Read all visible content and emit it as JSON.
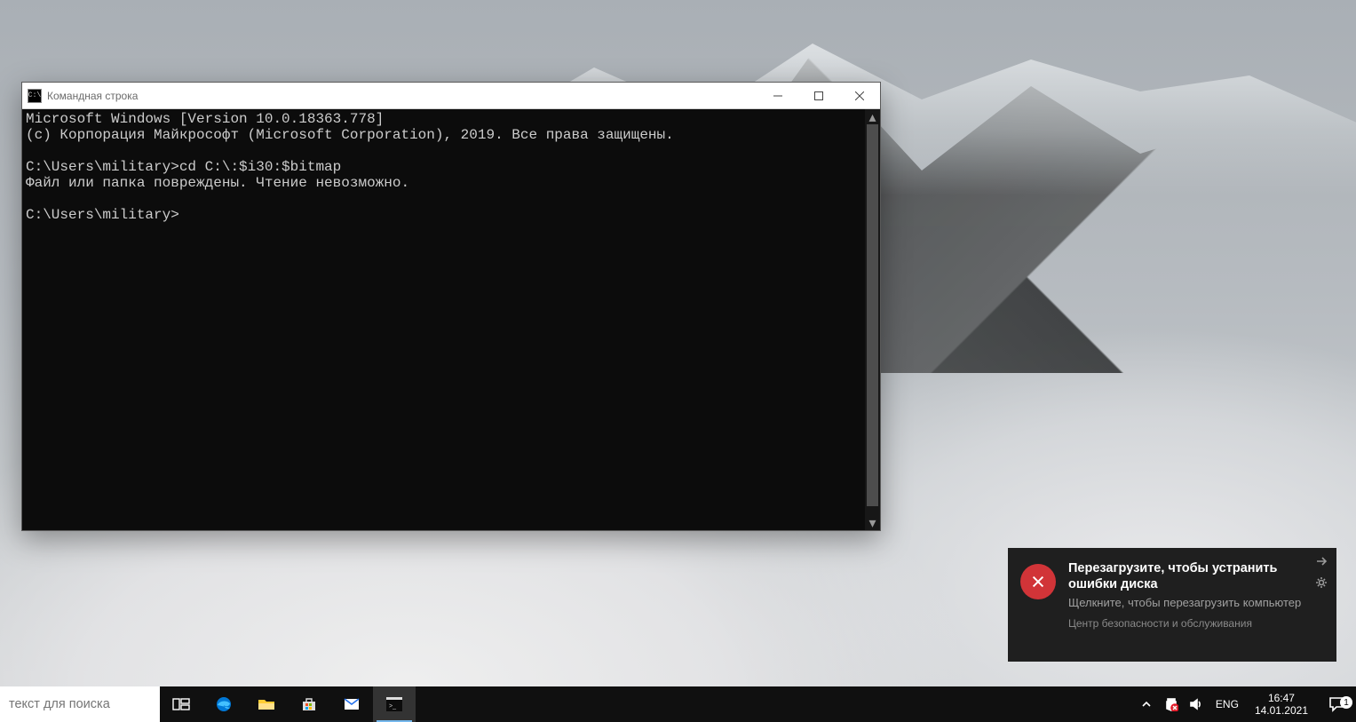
{
  "window": {
    "title": "Командная строка",
    "icon_glyph": "C:\\",
    "terminal_lines": [
      "Microsoft Windows [Version 10.0.18363.778]",
      "(c) Корпорация Майкрософт (Microsoft Corporation), 2019. Все права защищены.",
      "",
      "C:\\Users\\military>cd C:\\:$i30:$bitmap",
      "Файл или папка повреждены. Чтение невозможно.",
      "",
      "C:\\Users\\military>"
    ]
  },
  "toast": {
    "title": "Перезагрузите, чтобы устранить ошибки диска",
    "subtitle": "Щелкните, чтобы перезагрузить компьютер",
    "source": "Центр безопасности и обслуживания"
  },
  "taskbar": {
    "search_placeholder": "текст для поиска",
    "lang": "ENG",
    "time": "16:47",
    "date": "14.01.2021",
    "notif_count": "1"
  }
}
